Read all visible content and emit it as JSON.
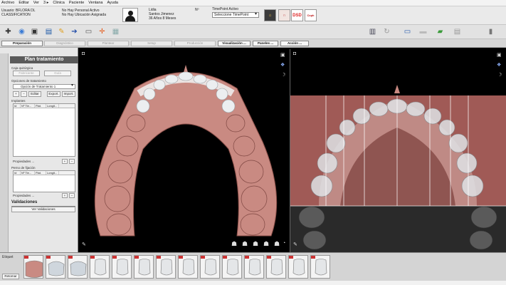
{
  "menu": [
    "Archivo",
    "Editar",
    "Ver",
    "3 ▸",
    "Clinica",
    "Paciente",
    "Ventana",
    "Ayuda"
  ],
  "info": {
    "user_line": "Usuario: BFLORA DL",
    "classification": "CLASSIFICATION",
    "personal_line": "No Hay Personal Activo",
    "location_line": "No Hay Ubicación Asignada",
    "patient_name": "Lidia",
    "patient_surname": "Santos Jimenez",
    "patient_age": "36 Años 8 Meses",
    "patient_no": "Nº",
    "timepoint_label": "TimePoint Activo",
    "timepoint_value": "Seleccione TimePoint",
    "app_dsd": "DSD",
    "app_ceph": "Ceph"
  },
  "steps": [
    "Preparación",
    "Diagnóstico",
    "Plantear",
    "Setup",
    "Producción",
    "Visualización ...",
    "Paneles ...",
    "Acción ..."
  ],
  "panel": {
    "title": "Plan tratamiento",
    "section_quirurgica": "Caja quirúrgica",
    "btn_fabricante": "Fabricante",
    "btn_guia": "Guía",
    "section_opciones": "Opciones de tratamiento",
    "option_value": "Opción de Tratamiento 1",
    "btn_add": "+",
    "btn_remove": "−",
    "btn_editar": "Editar",
    "btn_export": "Export.",
    "btn_import": "Import.",
    "section_implantes": "Implantes",
    "col_id": "Id",
    "col_tipo": "Nº Tie...",
    "col_plat": "Plat.",
    "col_long": "Longit...",
    "propiedades": "Propiedades ...",
    "section_pernos": "Perno de fijación",
    "validaciones_title": "Validaciones",
    "btn_ver_validaciones": "Ver Validaciones"
  },
  "bottom": {
    "etiquetas": "Etiquet",
    "retomar": "Retomar",
    "thumb_count": 14
  },
  "colors": {
    "gum": "#c98a82",
    "tooth": "#e8eaec",
    "panel_head": "#5a5a5a",
    "accent_blue": "#1f4aa8"
  }
}
